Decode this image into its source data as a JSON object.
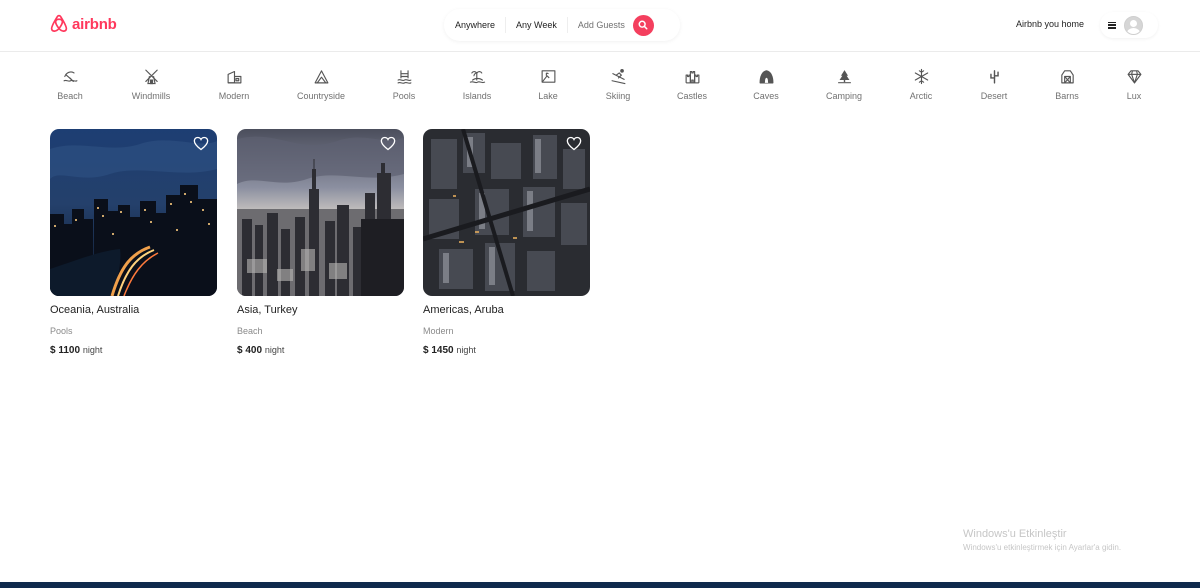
{
  "brand": {
    "name": "airbnb",
    "color": "#ff385c"
  },
  "search": {
    "where": "Anywhere",
    "when": "Any Week",
    "guests": "Add Guests",
    "button_icon": "search-icon"
  },
  "nav": {
    "host_link": "Airbnb you home",
    "menu_icon": "hamburger-icon",
    "avatar_icon": "user-avatar-icon"
  },
  "categories": [
    {
      "label": "Beach",
      "icon": "beach-icon"
    },
    {
      "label": "Windmills",
      "icon": "windmill-icon"
    },
    {
      "label": "Modern",
      "icon": "modern-house-icon"
    },
    {
      "label": "Countryside",
      "icon": "mountain-icon"
    },
    {
      "label": "Pools",
      "icon": "pool-icon"
    },
    {
      "label": "Islands",
      "icon": "island-icon"
    },
    {
      "label": "Lake",
      "icon": "lake-icon"
    },
    {
      "label": "Skiing",
      "icon": "skiing-icon"
    },
    {
      "label": "Castles",
      "icon": "castle-icon"
    },
    {
      "label": "Caves",
      "icon": "cave-icon"
    },
    {
      "label": "Camping",
      "icon": "camping-icon"
    },
    {
      "label": "Arctic",
      "icon": "snowflake-icon"
    },
    {
      "label": "Desert",
      "icon": "cactus-icon"
    },
    {
      "label": "Barns",
      "icon": "barn-icon"
    },
    {
      "label": "Lux",
      "icon": "diamond-icon"
    }
  ],
  "listings": [
    {
      "location": "Oceania, Australia",
      "category": "Pools",
      "price": "$ 1100",
      "unit": "night"
    },
    {
      "location": "Asia, Turkey",
      "category": "Beach",
      "price": "$ 400",
      "unit": "night"
    },
    {
      "location": "Americas, Aruba",
      "category": "Modern",
      "price": "$ 1450",
      "unit": "night"
    }
  ],
  "watermark": {
    "title": "Windows'u Etkinleştir",
    "subtitle": "Windows'u etkinleştirmek için Ayarlar'a gidin."
  }
}
